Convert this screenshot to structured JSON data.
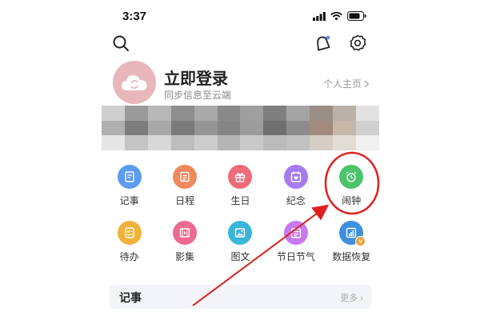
{
  "status_bar": {
    "time": "3:37",
    "icons": [
      "signal-icon",
      "wifi-icon",
      "battery-icon"
    ]
  },
  "top_bar": {
    "icons": [
      "search-icon",
      "notification-bell-icon",
      "settings-gear-icon"
    ]
  },
  "profile": {
    "title": "立即登录",
    "subtitle": "同步信息至云端",
    "link_label": "个人主页",
    "avatar_icon": "cloud-sync-icon"
  },
  "features": [
    {
      "label": "记事",
      "icon": "note-icon",
      "color": "#5b9cf0"
    },
    {
      "label": "日程",
      "icon": "schedule-icon",
      "color": "#f0895b"
    },
    {
      "label": "生日",
      "icon": "gift-icon",
      "color": "#f06b7a"
    },
    {
      "label": "纪念",
      "icon": "anniversary-icon",
      "color": "#a57bf0"
    },
    {
      "label": "闹钟",
      "icon": "alarm-clock-icon",
      "color": "#4cc46a"
    },
    {
      "label": "待办",
      "icon": "todo-icon",
      "color": "#f0b23b"
    },
    {
      "label": "影集",
      "icon": "album-icon",
      "color": "#ef6a8f"
    },
    {
      "label": "图文",
      "icon": "image-text-icon",
      "color": "#3ab6d8"
    },
    {
      "label": "节日节气",
      "icon": "festival-icon",
      "color": "#c77af0"
    },
    {
      "label": "数据恢复",
      "icon": "data-restore-icon",
      "color": "#3f8fe0"
    }
  ],
  "notes_section": {
    "title": "记事",
    "more_label": "更多"
  },
  "annotation": {
    "highlight_color": "#e02020"
  }
}
